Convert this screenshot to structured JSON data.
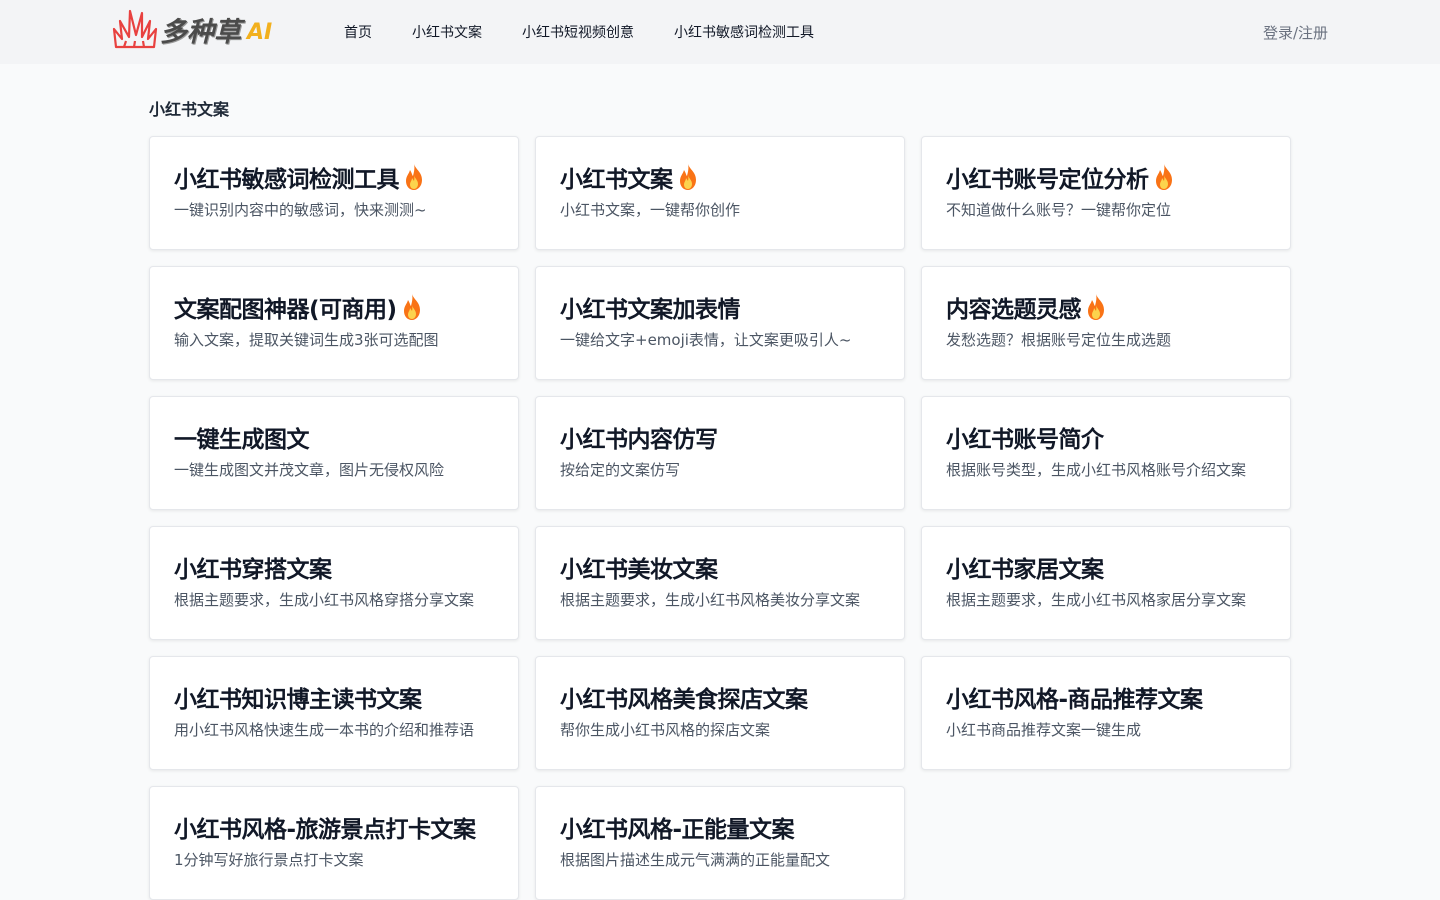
{
  "header": {
    "logo_text": "多种草",
    "logo_ai": "AI",
    "nav": [
      "首页",
      "小红书文案",
      "小红书短视频创意",
      "小红书敏感词检测工具"
    ],
    "login": "登录/注册"
  },
  "section": {
    "title": "小红书文案"
  },
  "colors": {
    "header_bg": "#f3f4f6",
    "page_bg": "#f9fafb",
    "logo_ai": "#f2b01e",
    "logo_mark": "#e8413f",
    "fire": "#f97316"
  },
  "cards": [
    {
      "title": "小红书敏感词检测工具",
      "desc": "一键识别内容中的敏感词，快来测测~",
      "icon": "fire-icon"
    },
    {
      "title": "小红书文案",
      "desc": "小红书文案，一键帮你创作",
      "icon": "fire-icon"
    },
    {
      "title": "小红书账号定位分析",
      "desc": "不知道做什么账号？一键帮你定位",
      "icon": "fire-icon"
    },
    {
      "title": "文案配图神器(可商用)",
      "desc": "输入文案，提取关键词生成3张可选配图",
      "icon": "fire-icon"
    },
    {
      "title": "小红书文案加表情",
      "desc": "一键给文字+emoji表情，让文案更吸引人~",
      "icon": ""
    },
    {
      "title": "内容选题灵感",
      "desc": "发愁选题？根据账号定位生成选题",
      "icon": "fire-icon"
    },
    {
      "title": "一键生成图文",
      "desc": "一键生成图文并茂文章，图片无侵权风险",
      "icon": ""
    },
    {
      "title": "小红书内容仿写",
      "desc": "按给定的文案仿写",
      "icon": ""
    },
    {
      "title": "小红书账号简介",
      "desc": "根据账号类型，生成小红书风格账号介绍文案",
      "icon": ""
    },
    {
      "title": "小红书穿搭文案",
      "desc": "根据主题要求，生成小红书风格穿搭分享文案",
      "icon": ""
    },
    {
      "title": "小红书美妆文案",
      "desc": "根据主题要求，生成小红书风格美妆分享文案",
      "icon": ""
    },
    {
      "title": "小红书家居文案",
      "desc": "根据主题要求，生成小红书风格家居分享文案",
      "icon": ""
    },
    {
      "title": "小红书知识博主读书文案",
      "desc": "用小红书风格快速生成一本书的介绍和推荐语",
      "icon": ""
    },
    {
      "title": "小红书风格美食探店文案",
      "desc": "帮你生成小红书风格的探店文案",
      "icon": ""
    },
    {
      "title": "小红书风格-商品推荐文案",
      "desc": "小红书商品推荐文案一键生成",
      "icon": ""
    },
    {
      "title": "小红书风格-旅游景点打卡文案",
      "desc": "1分钟写好旅行景点打卡文案",
      "icon": ""
    },
    {
      "title": "小红书风格-正能量文案",
      "desc": "根据图片描述生成元气满满的正能量配文",
      "icon": ""
    }
  ]
}
